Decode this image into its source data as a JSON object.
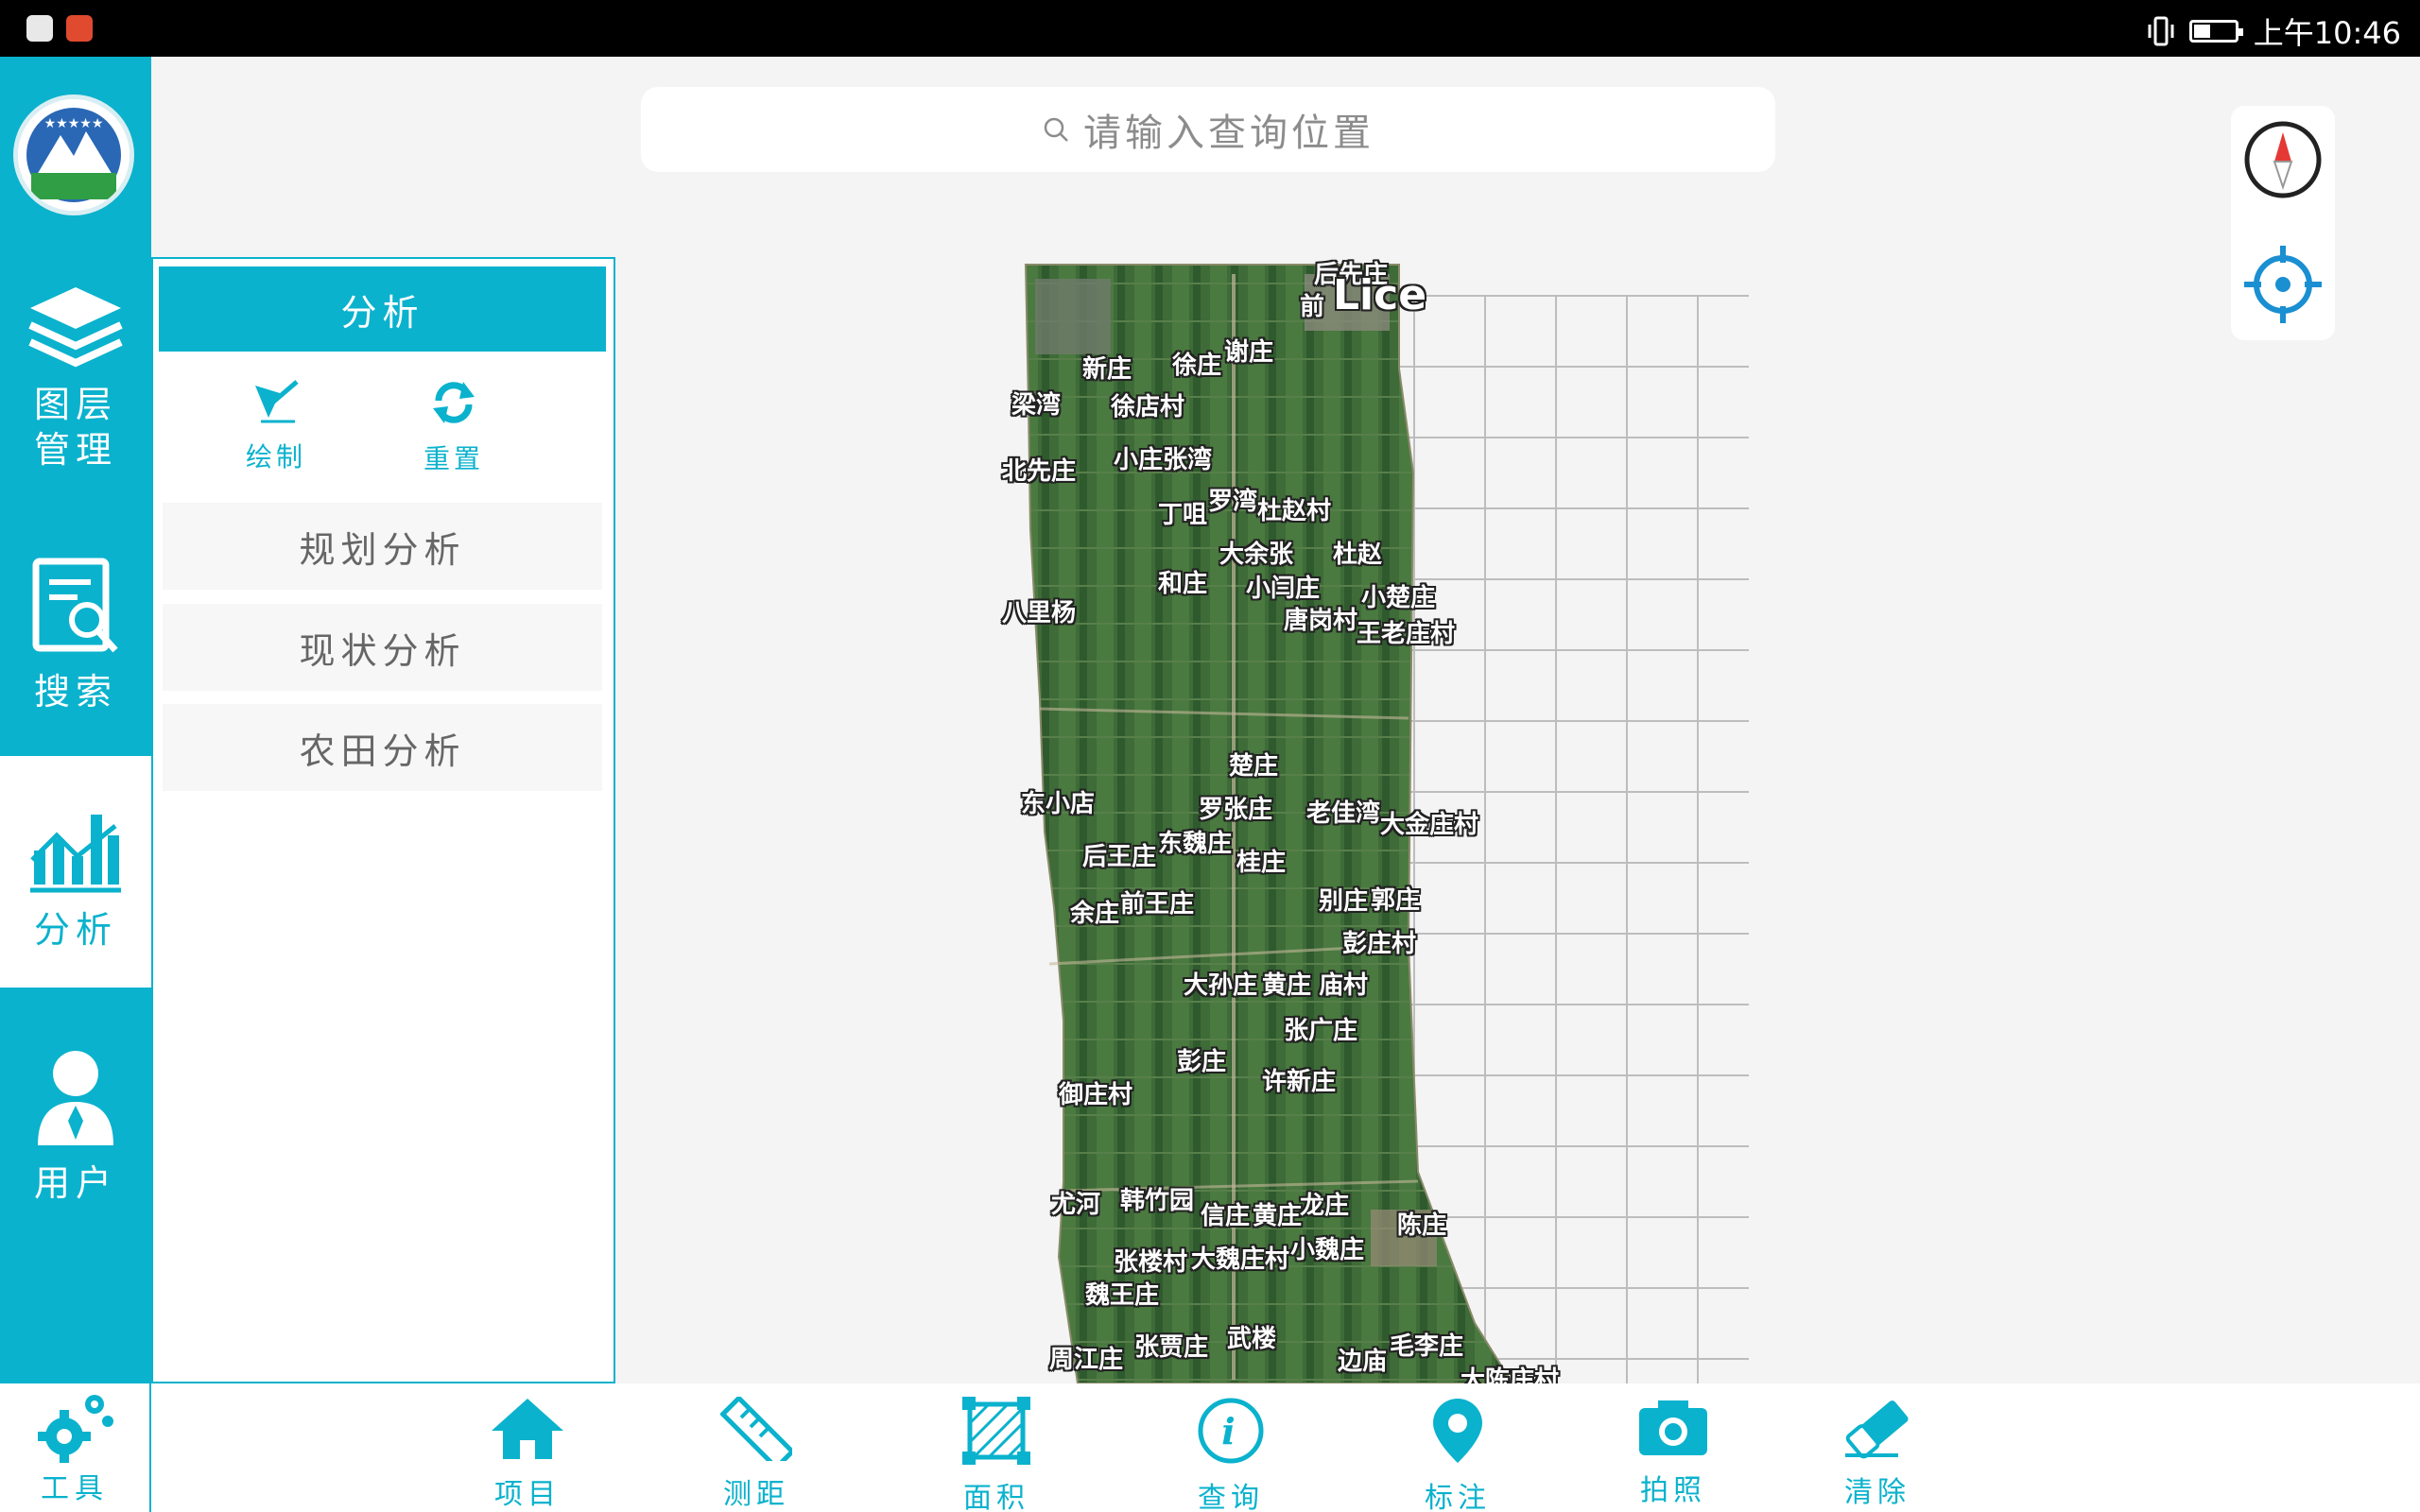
{
  "status_bar": {
    "time": "上午10:46"
  },
  "rail": {
    "layers_label": "图层\n管理",
    "layers_line1": "图层",
    "layers_line2": "管理",
    "search_label": "搜索",
    "analysis_label": "分析",
    "user_label": "用户",
    "tools_label": "工具"
  },
  "panel": {
    "title": "分析",
    "draw_label": "绘制",
    "reset_label": "重置",
    "rows": [
      "规划分析",
      "现状分析",
      "农田分析"
    ]
  },
  "search": {
    "placeholder": "请输入查询位置"
  },
  "map": {
    "places": [
      "后先庄",
      "前",
      "Lice",
      "新庄",
      "徐庄",
      "谢庄",
      "梁湾",
      "徐店村",
      "北先庄",
      "小庄张湾",
      "丁咀",
      "罗湾",
      "杜赵村",
      "大余张",
      "杜赵",
      "和庄",
      "小闫庄",
      "小楚庄",
      "八里杨",
      "唐岗村",
      "王老庄村",
      "楚庄",
      "东小店",
      "罗张庄",
      "老佳湾",
      "大金庄村",
      "后王庄",
      "东魏庄",
      "桂庄",
      "余庄",
      "前王庄",
      "别庄",
      "郭庄",
      "彭庄村",
      "大孙庄",
      "黄庄",
      "庙村",
      "张广庄",
      "彭庄",
      "许新庄",
      "御庄村",
      "尤河",
      "韩竹园",
      "信庄",
      "黄庄",
      "龙庄",
      "陈庄",
      "张楼村",
      "大魏庄村",
      "小魏庄",
      "魏王庄",
      "武楼",
      "周江庄",
      "张贾庄",
      "边庙",
      "毛李庄",
      "大陈庄村"
    ]
  },
  "toolbar": {
    "items": [
      "项目",
      "测距",
      "面积",
      "查询",
      "标注",
      "拍照",
      "清除"
    ]
  },
  "colors": {
    "accent": "#0ab2cd",
    "map_green": "#3f6a3a"
  }
}
